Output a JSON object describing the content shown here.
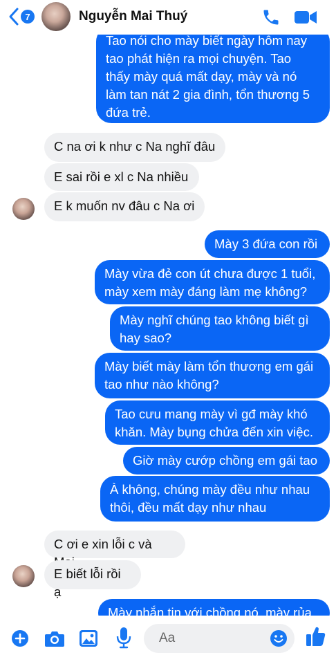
{
  "header": {
    "unread_count": "7",
    "contact_name": "Nguyễn Mai Thuý",
    "icons": [
      "back-chevron-icon",
      "phone-icon",
      "video-camera-icon"
    ]
  },
  "messages": [
    {
      "dir": "out",
      "lines": [
        "Tao nói cho mày biết ngày hôm nay",
        "tao phát hiện ra mọi chuyện. Tao",
        "thấy mày quá mất dạy, mày và nó",
        "làm tan nát 2 gia đình, tổn thương 5",
        "đứa trẻ."
      ]
    },
    {
      "dir": "in",
      "lines": [
        "C na ơi k như c Na nghĩ đâu"
      ]
    },
    {
      "dir": "in",
      "lines": [
        "E sai rồi e xl c Na nhiều"
      ]
    },
    {
      "dir": "in",
      "lines": [
        "E k muốn nv đâu c Na ơi"
      ]
    },
    {
      "dir": "out",
      "lines": [
        "Mày 3 đứa con rồi"
      ]
    },
    {
      "dir": "out",
      "lines": [
        "Mày vừa đẻ con út chưa được 1 tuổi,",
        "mày xem mày đáng làm mẹ không?"
      ]
    },
    {
      "dir": "out",
      "lines": [
        "Mày nghĩ chúng tao không biết gì",
        "hay sao?"
      ]
    },
    {
      "dir": "out",
      "lines": [
        "Mày biết mày làm tổn thương em gái",
        "tao như nào không?"
      ]
    },
    {
      "dir": "out",
      "lines": [
        "Tao cưu mang mày vì gđ mày khó",
        "khăn. Mày bụng chửa đến xin việc."
      ]
    },
    {
      "dir": "out",
      "lines": [
        "Giờ mày cướp chồng em gái tao"
      ]
    },
    {
      "dir": "out",
      "lines": [
        "À không, chúng mày đều như nhau",
        "thôi, đều mất dạy như nhau"
      ]
    },
    {
      "dir": "in",
      "lines": [
        "C ơi e xin lỗi c và Mai"
      ]
    },
    {
      "dir": "in",
      "lines": [
        "E biết lỗi rồi ạ"
      ]
    },
    {
      "dir": "out",
      "lines": [
        "Mày nhắn tin với chồng nó, mày rủa"
      ]
    }
  ],
  "composer": {
    "placeholder": "Aa",
    "icons": [
      "plus-icon",
      "camera-icon",
      "image-icon",
      "microphone-icon",
      "emoji-icon",
      "thumbs-up-icon"
    ]
  },
  "colors": {
    "outgoing_bubble": "#0a66f5",
    "incoming_bubble": "#eff0f2",
    "accent": "#1877f2"
  }
}
